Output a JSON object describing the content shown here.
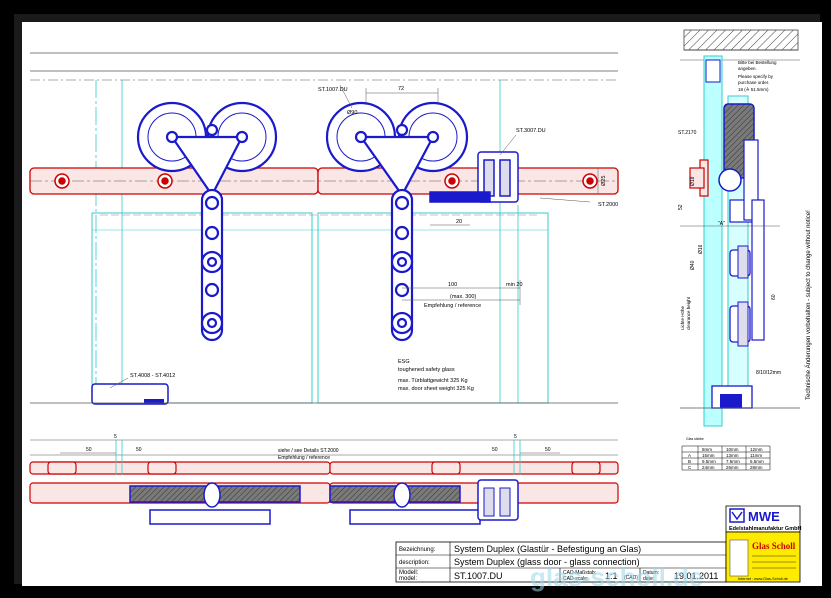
{
  "drawing": {
    "labels": {
      "st1007du": "ST.1007.DU",
      "st3007du": "ST.3007.DU",
      "st2000": "ST.2000",
      "st4008": "ST.4008 - ST.4012",
      "st2170": "ST.2170",
      "dim_72": "72",
      "dim_100": "100",
      "dim_min20": "min 20",
      "dim_max300": "(max. 300)",
      "empfehlung": "Empfehlung / reference",
      "dim_20": "20",
      "dim_d25": "Ø25",
      "dim_d90": "Ø90",
      "esg_title": "ESG",
      "esg_en": "toughened safety glass",
      "weight_de": "max. Türblattgewicht 325 Kg",
      "weight_en": "max. door sheet weight 325 Kg",
      "siehe": "siehe / see Details ST.2000",
      "empfehlung2": "Empfehlung / reference",
      "dim_50a": "50",
      "dim_50b": "50",
      "dim_50c": "50",
      "dim_50d": "50",
      "dim_5a": "5",
      "dim_5b": "5",
      "bitte": "Bitte bei Bestellung",
      "angeben": "angeben.",
      "please": "Please specify by",
      "purchase": "purchase order.",
      "glass_thick": "18 (≙ 51.5mm)",
      "dim_52": "52",
      "dim_60": "60",
      "dim_a": "\"A\"",
      "dim_810": "8/10/12mm",
      "lichte": "Lichte Höhe",
      "clearance": "clearance height",
      "d40": "Ø40",
      "d16": "Ø16",
      "d18": "Ø18",
      "glasstable_header": "Glas stärke",
      "side_note": "Technische Änderungen vorbehalten - subject to change without notice!"
    },
    "glass_table": {
      "columns": [
        "8mm",
        "10mm",
        "12mm"
      ],
      "rows": [
        {
          "label": "A",
          "values": [
            "15mm",
            "13mm",
            "11mm"
          ]
        },
        {
          "label": "B",
          "values": [
            "9.5mm",
            "7.5mm",
            "5.5mm"
          ]
        },
        {
          "label": "C",
          "values": [
            "24mm",
            "26mm",
            "28mm"
          ]
        }
      ]
    }
  },
  "title_block": {
    "row1_label": "Bezeichnung:",
    "row1_value": "System Duplex (Glastür - Befestigung an Glas)",
    "row2_label": "description:",
    "row2_value": "System Duplex (glass door - glass connection)",
    "row3_label_a": "Modell:",
    "row3_label_b": "model:",
    "row3_value": "ST.1007.DU",
    "scale_label_a": "CAD-Maßstab:",
    "scale_label_b": "CAD-scale:",
    "scale_value": "1:1",
    "scale_note": "(CAD)",
    "date_label_a": "Datum:",
    "date_label_b": "date:",
    "date_value": "19.01.2011"
  },
  "company": {
    "logo": "MWE",
    "name": "Edelstahlmanufaktur GmbH",
    "partner_logo": "Glas Scholl",
    "internet": "Internet : www.Glas-Scholl.de",
    "watermark": "glas-scholl.de"
  }
}
